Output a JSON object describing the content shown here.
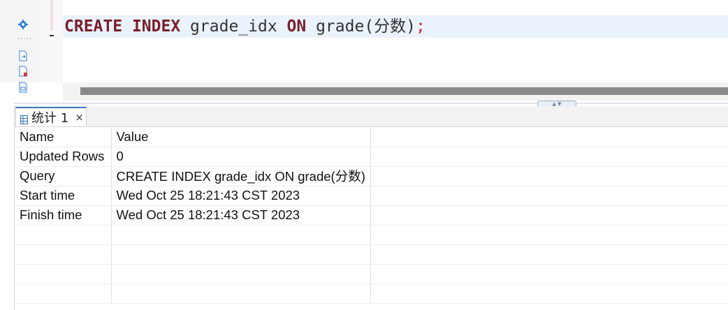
{
  "editor": {
    "tokens": [
      {
        "text": "CREATE",
        "kind": "kw"
      },
      {
        "text": " ",
        "kind": "plain"
      },
      {
        "text": "INDEX",
        "kind": "kw"
      },
      {
        "text": " grade_idx ",
        "kind": "plain"
      },
      {
        "text": "ON",
        "kind": "kw"
      },
      {
        "text": " grade(分数)",
        "kind": "plain"
      },
      {
        "text": ";",
        "kind": "semi"
      }
    ]
  },
  "gutter_icons": [
    "settings-gear-icon",
    "export-file-icon",
    "file-error-icon",
    "file-data-icon"
  ],
  "results": {
    "tab_label": "统计 1",
    "tab_close": "×",
    "header": {
      "name": "Name",
      "value": "Value"
    },
    "rows": [
      {
        "name": "Updated Rows",
        "value": "0"
      },
      {
        "name": "Query",
        "value": "CREATE INDEX grade_idx ON grade(分数)"
      },
      {
        "name": "Start time",
        "value": "Wed Oct 25 18:21:43 CST 2023"
      },
      {
        "name": "Finish time",
        "value": "Wed Oct 25 18:21:43 CST 2023"
      }
    ],
    "empty_row_count": 4
  },
  "colors": {
    "keyword": "#7a1f2b",
    "semicolon": "#d02020",
    "current_line": "#eaf2fb",
    "tab_accent": "#3b78c4"
  }
}
